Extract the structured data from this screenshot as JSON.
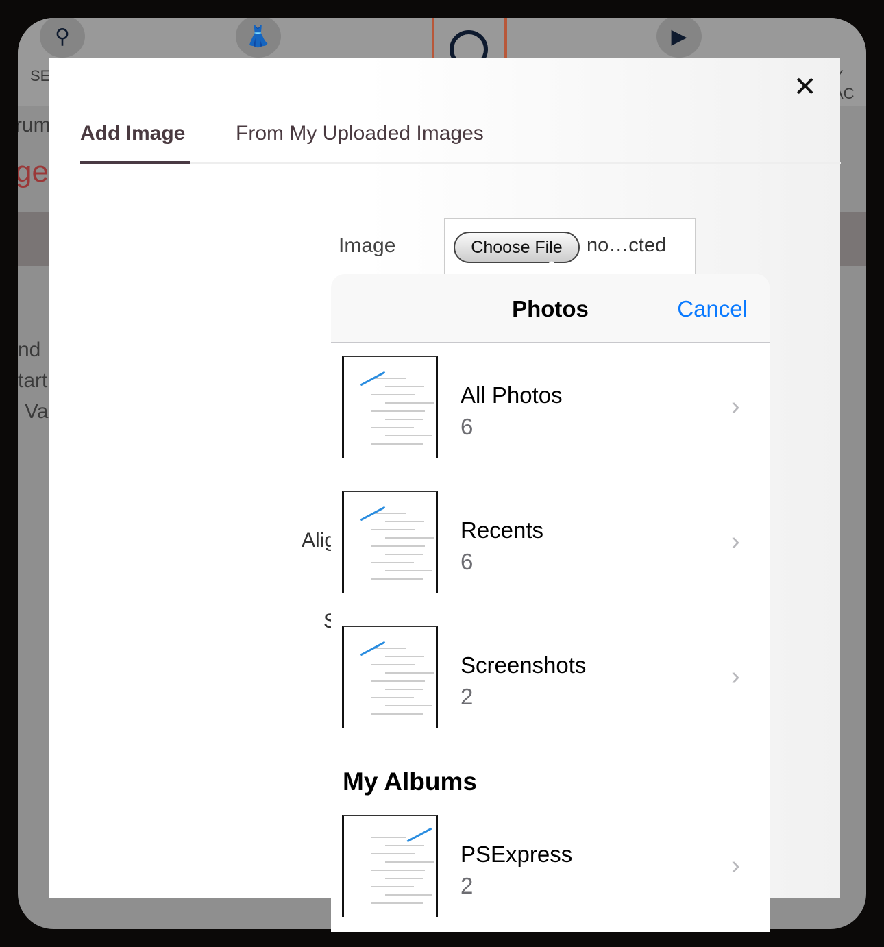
{
  "background": {
    "top_icons": [
      "search-icon",
      "dress-icon",
      "ring-icon",
      "video-icon"
    ],
    "labels": {
      "left_top": "SE",
      "right_top": "Y AC",
      "left1": "rum",
      "left2": "ge",
      "left3": "nd",
      "left4": "tart",
      "left5": "Va"
    }
  },
  "modal": {
    "tabs": [
      {
        "label": "Add Image",
        "active": true
      },
      {
        "label": "From My Uploaded Images",
        "active": false
      }
    ],
    "image_label": "Image",
    "choose_file_label": "Choose File",
    "file_status": "no…cted",
    "align_label": "Alig",
    "s_label": "S"
  },
  "picker": {
    "title": "Photos",
    "cancel_label": "Cancel",
    "albums": [
      {
        "name": "All Photos",
        "count": "6"
      },
      {
        "name": "Recents",
        "count": "6"
      },
      {
        "name": "Screenshots",
        "count": "2"
      }
    ],
    "my_albums_heading": "My Albums",
    "my_albums": [
      {
        "name": "PSExpress",
        "count": "2"
      }
    ]
  },
  "colors": {
    "accent": "#0a7aff",
    "tab_active": "#4a3a44"
  }
}
